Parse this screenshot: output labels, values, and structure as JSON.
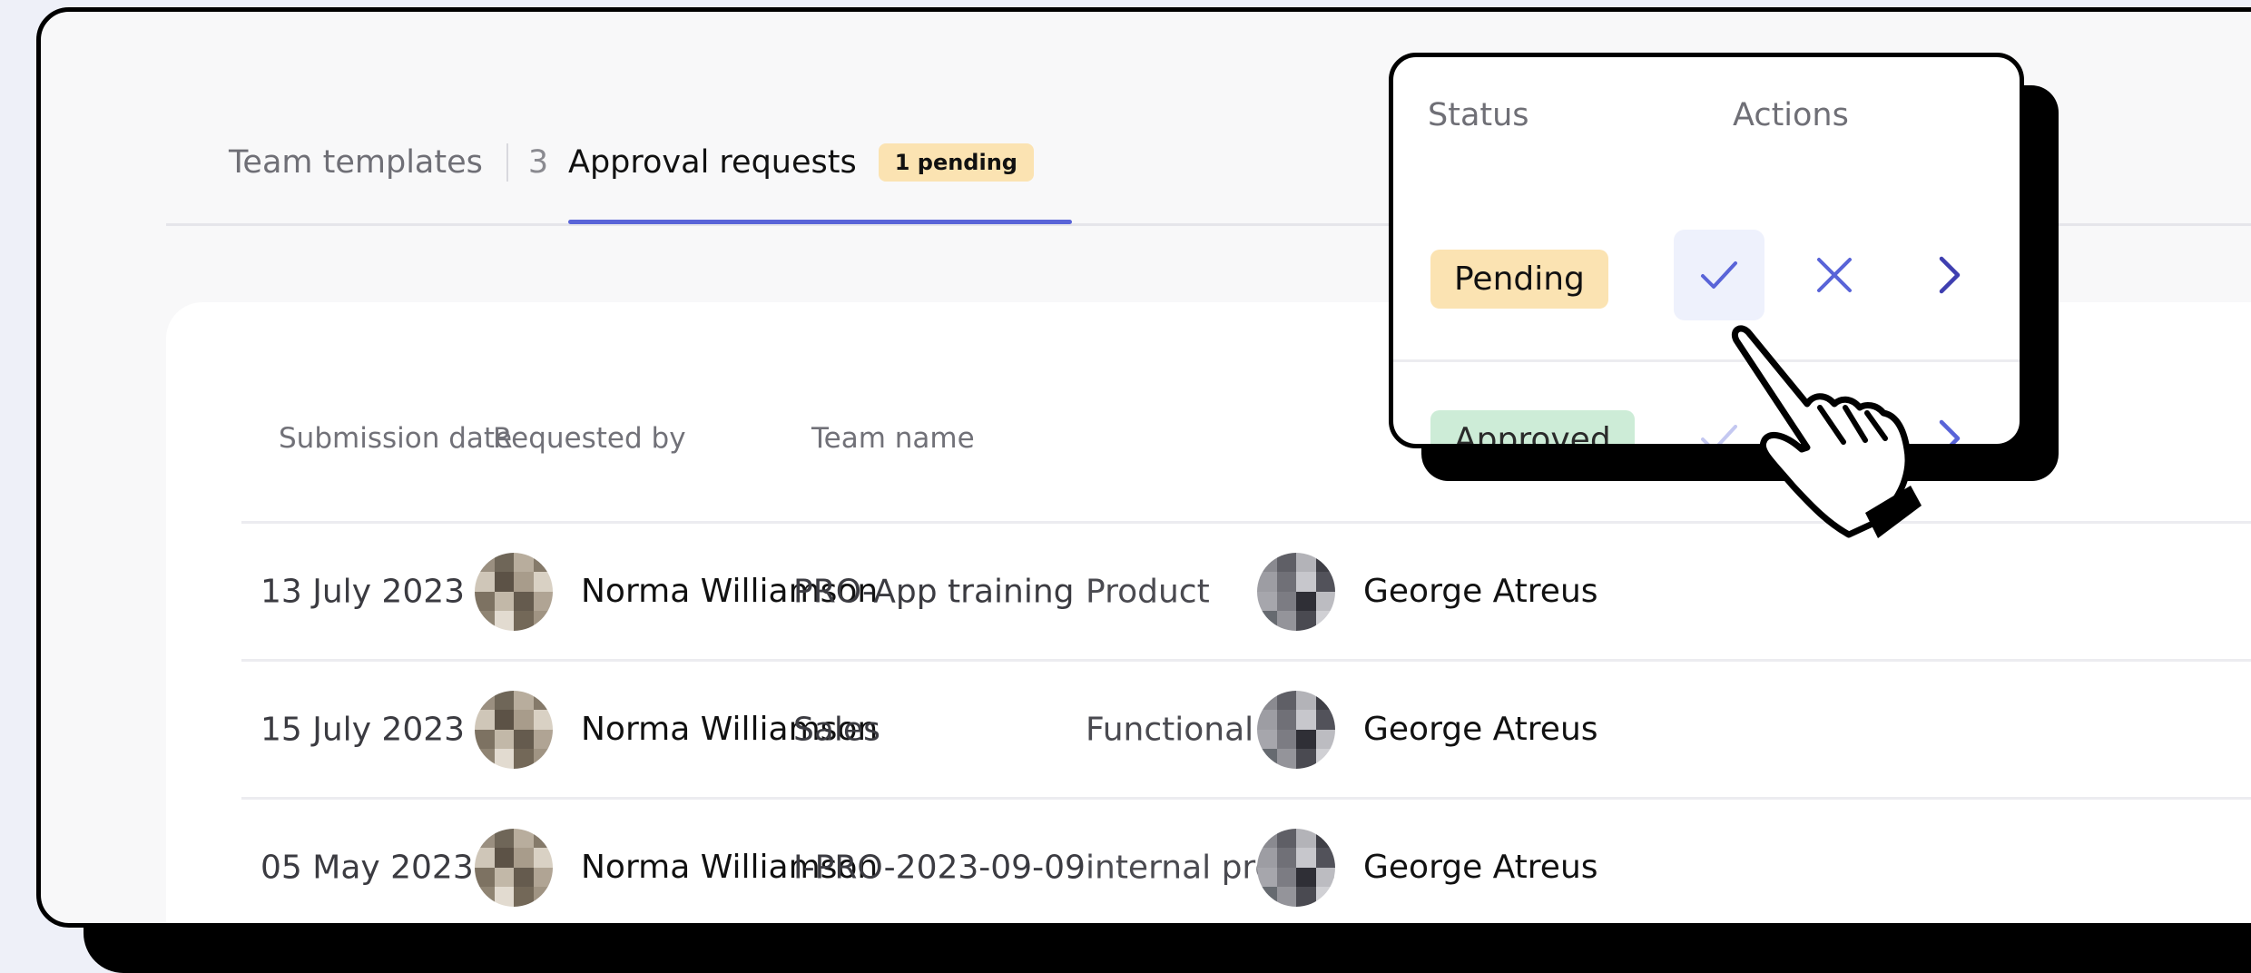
{
  "tabs": {
    "templates_label": "Team templates",
    "templates_count": "3",
    "approval_label": "Approval requests",
    "pending_badge": "1 pending"
  },
  "table": {
    "headers": {
      "submission_date": "Submission date",
      "requested_by": "Requested by",
      "team_name": "Team name"
    },
    "rows": [
      {
        "date": "13 July 2023",
        "requested_by": "Norma Williamson",
        "team_name": "PRO-App training",
        "type": "Product",
        "owner": "George Atreus"
      },
      {
        "date": "15 July 2023",
        "requested_by": "Norma Williamson",
        "team_name": "Sales",
        "type": "Functional",
        "owner": "George Atreus"
      },
      {
        "date": "05 May 2023",
        "requested_by": "Norma Williamson",
        "team_name": "I-PRO-2023-09-09",
        "type": "internal project",
        "owner": "George Atreus"
      }
    ]
  },
  "popup": {
    "status_header": "Status",
    "actions_header": "Actions",
    "rows": [
      {
        "status": "Pending"
      },
      {
        "status": "Approved"
      }
    ]
  },
  "icons": {
    "approve": "check-icon",
    "reject": "close-icon",
    "open": "chevron-right-icon",
    "cursor": "hand-pointer-icon"
  },
  "colors": {
    "accent": "#5964d8",
    "pending_bg": "#fbe3b2",
    "approved_bg": "#cdecd7",
    "approve_button_bg": "#eef1fc"
  }
}
